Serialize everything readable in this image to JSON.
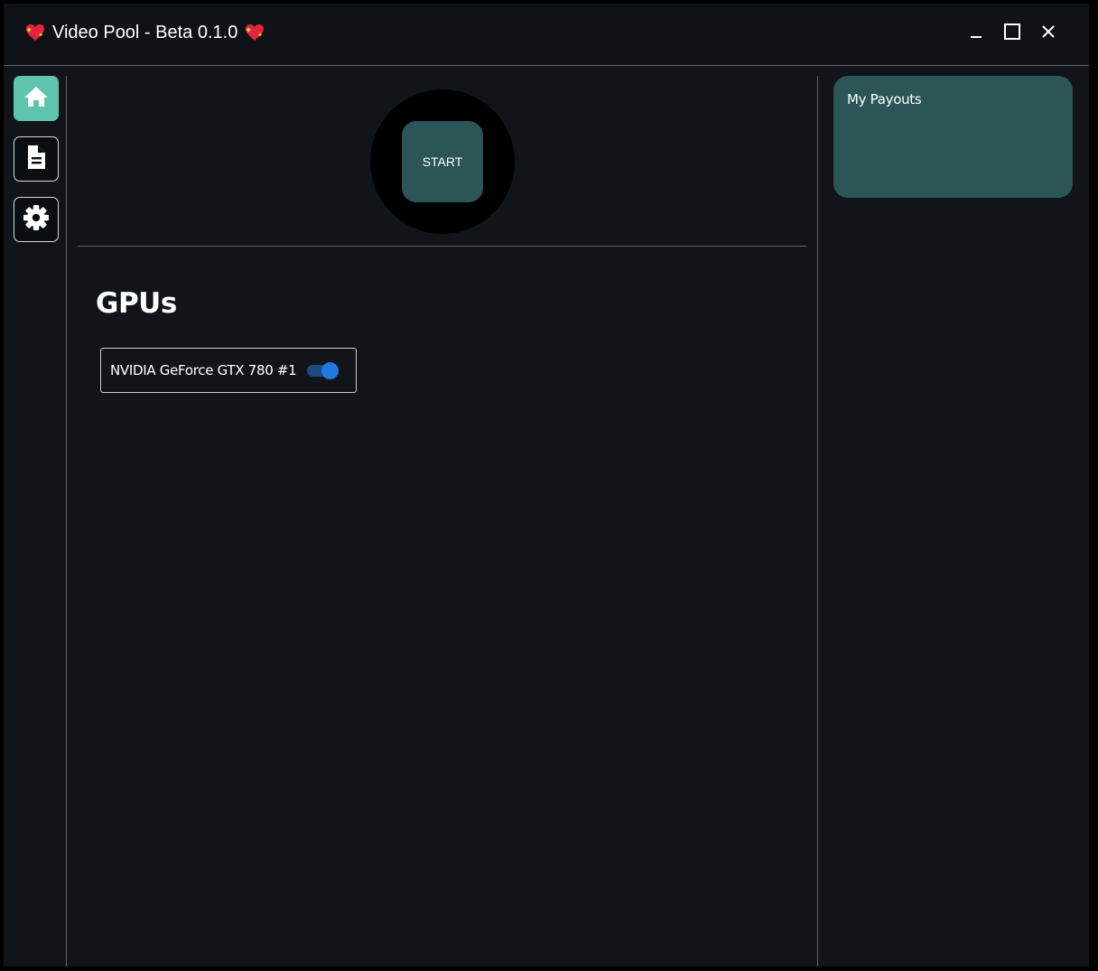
{
  "window": {
    "title": "Video Pool - Beta 0.1.0",
    "title_icon": "sparkling-heart-icon",
    "controls": [
      "minimize-icon",
      "maximize-icon",
      "close-icon"
    ]
  },
  "sidebar": {
    "items": [
      {
        "id": "home",
        "icon": "home-icon",
        "active": true
      },
      {
        "id": "logs",
        "icon": "document-icon",
        "active": false
      },
      {
        "id": "settings",
        "icon": "gear-icon",
        "active": false
      }
    ]
  },
  "main": {
    "start_label": "START",
    "gpus_heading": "GPUs",
    "gpus": [
      {
        "name": "NVIDIA GeForce GTX 780 #1",
        "enabled": true
      }
    ]
  },
  "payouts": {
    "title": "My Payouts"
  },
  "colors": {
    "background": "#11151a",
    "titlebar": "#0f1317",
    "accent_teal": "#5ec4ad",
    "card_teal": "#2c5558",
    "toggle_on": "#1f79e0",
    "divider": "#5c636b"
  }
}
